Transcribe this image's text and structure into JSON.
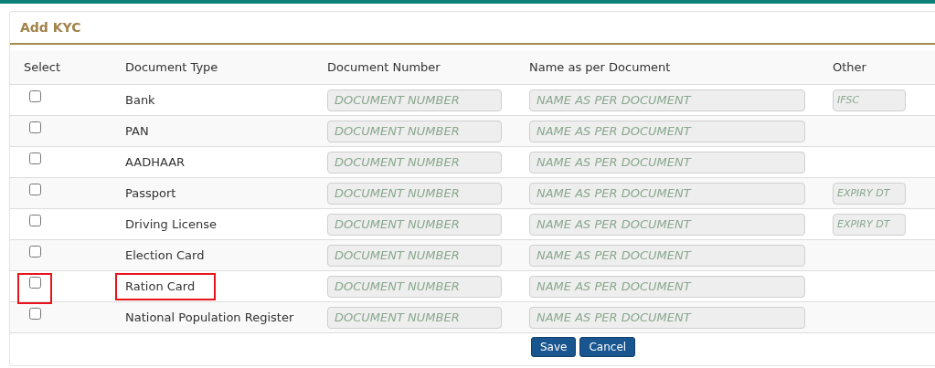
{
  "panel": {
    "title": "Add KYC"
  },
  "table": {
    "columns": [
      "Select",
      "Document Type",
      "Document Number",
      "Name as per Document",
      "Other"
    ],
    "rows": [
      {
        "checked": false,
        "highlighted": false,
        "document_type": "Bank",
        "document_number": {
          "placeholder": "DOCUMENT NUMBER"
        },
        "name": {
          "placeholder": "NAME AS PER DOCUMENT"
        },
        "other": {
          "placeholder": "IFSC"
        }
      },
      {
        "checked": false,
        "highlighted": false,
        "document_type": "PAN",
        "document_number": {
          "placeholder": "DOCUMENT NUMBER"
        },
        "name": {
          "placeholder": "NAME AS PER DOCUMENT"
        }
      },
      {
        "checked": false,
        "highlighted": false,
        "document_type": "AADHAAR",
        "document_number": {
          "placeholder": "DOCUMENT NUMBER"
        },
        "name": {
          "placeholder": "NAME AS PER DOCUMENT"
        }
      },
      {
        "checked": false,
        "highlighted": false,
        "document_type": "Passport",
        "document_number": {
          "placeholder": "DOCUMENT NUMBER"
        },
        "name": {
          "placeholder": "NAME AS PER DOCUMENT"
        },
        "other": {
          "placeholder": "EXPIRY DT"
        }
      },
      {
        "checked": false,
        "highlighted": false,
        "document_type": "Driving License",
        "document_number": {
          "placeholder": "DOCUMENT NUMBER"
        },
        "name": {
          "placeholder": "NAME AS PER DOCUMENT"
        },
        "other": {
          "placeholder": "EXPIRY DT"
        }
      },
      {
        "checked": false,
        "highlighted": false,
        "document_type": "Election Card",
        "document_number": {
          "placeholder": "DOCUMENT NUMBER"
        },
        "name": {
          "placeholder": "NAME AS PER DOCUMENT"
        }
      },
      {
        "checked": false,
        "highlighted": true,
        "document_type": "Ration Card",
        "document_number": {
          "placeholder": "DOCUMENT NUMBER"
        },
        "name": {
          "placeholder": "NAME AS PER DOCUMENT"
        }
      },
      {
        "checked": false,
        "highlighted": false,
        "document_type": "National Population Register",
        "document_number": {
          "placeholder": "DOCUMENT NUMBER"
        },
        "name": {
          "placeholder": "NAME AS PER DOCUMENT"
        }
      }
    ]
  },
  "buttons": [
    "Save",
    "Cancel"
  ]
}
